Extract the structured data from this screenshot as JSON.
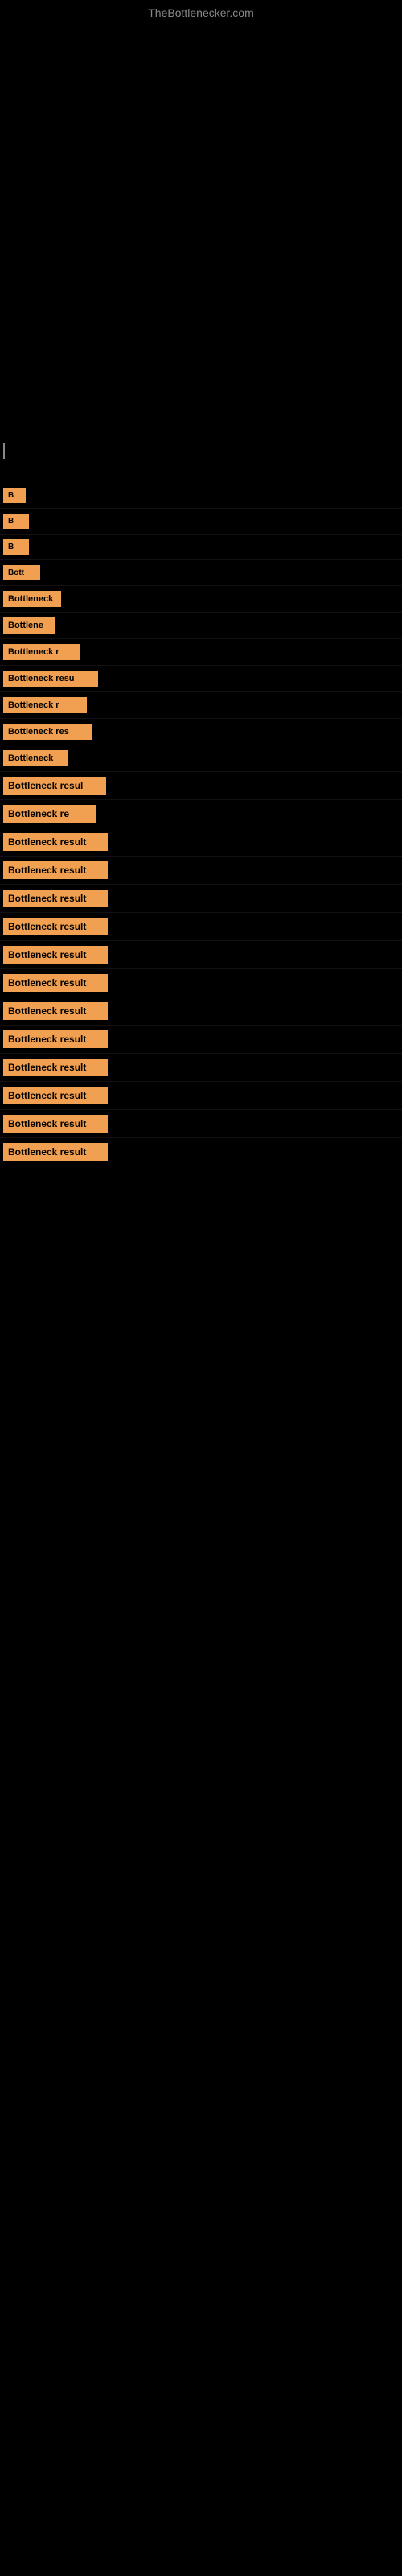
{
  "site": {
    "title": "TheBottlenecker.com"
  },
  "items": [
    {
      "id": 1,
      "label": "B"
    },
    {
      "id": 2,
      "label": "B"
    },
    {
      "id": 3,
      "label": "B"
    },
    {
      "id": 4,
      "label": "Bott"
    },
    {
      "id": 5,
      "label": "Bottleneck"
    },
    {
      "id": 6,
      "label": "Bottlene"
    },
    {
      "id": 7,
      "label": "Bottleneck r"
    },
    {
      "id": 8,
      "label": "Bottleneck resu"
    },
    {
      "id": 9,
      "label": "Bottleneck r"
    },
    {
      "id": 10,
      "label": "Bottleneck res"
    },
    {
      "id": 11,
      "label": "Bottleneck"
    },
    {
      "id": 12,
      "label": "Bottleneck resul"
    },
    {
      "id": 13,
      "label": "Bottleneck re"
    },
    {
      "id": 14,
      "label": "Bottleneck result"
    },
    {
      "id": 15,
      "label": "Bottleneck result"
    },
    {
      "id": 16,
      "label": "Bottleneck result"
    },
    {
      "id": 17,
      "label": "Bottleneck result"
    },
    {
      "id": 18,
      "label": "Bottleneck result"
    },
    {
      "id": 19,
      "label": "Bottleneck result"
    },
    {
      "id": 20,
      "label": "Bottleneck result"
    },
    {
      "id": 21,
      "label": "Bottleneck result"
    },
    {
      "id": 22,
      "label": "Bottleneck result"
    },
    {
      "id": 23,
      "label": "Bottleneck result"
    },
    {
      "id": 24,
      "label": "Bottleneck result"
    },
    {
      "id": 25,
      "label": "Bottleneck result"
    }
  ]
}
